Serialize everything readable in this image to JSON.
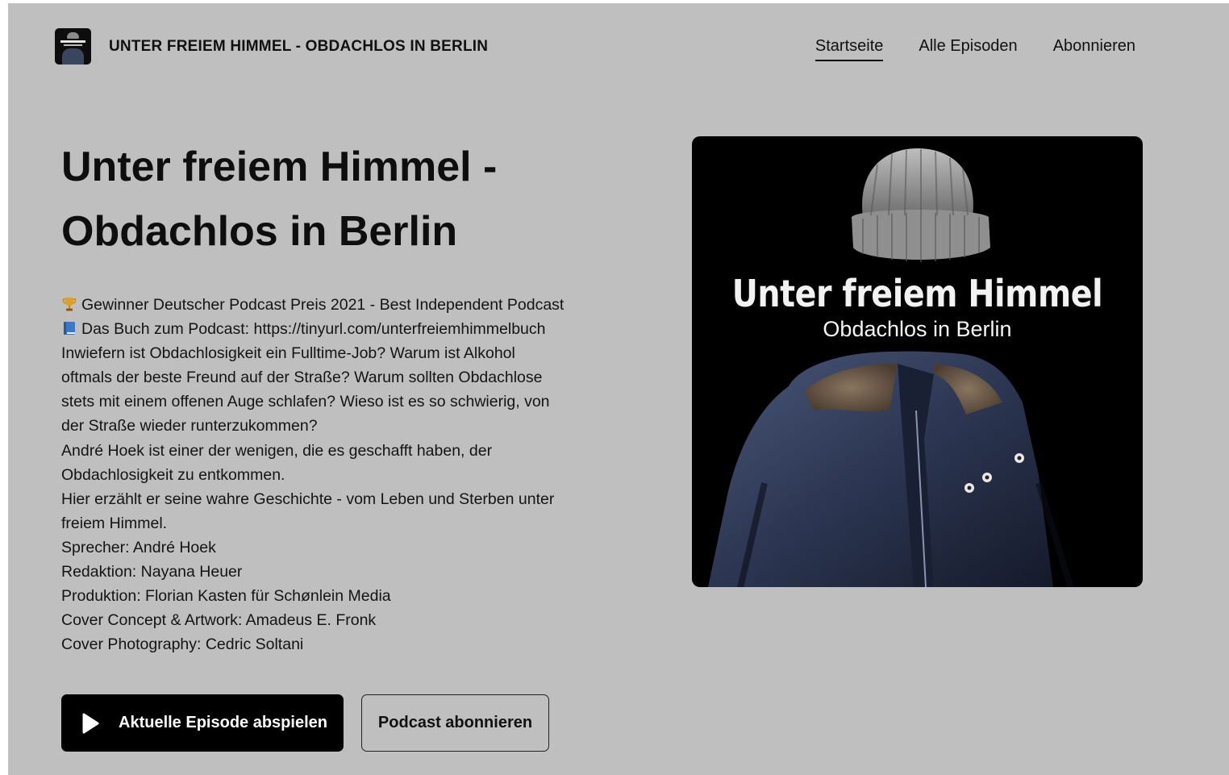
{
  "header": {
    "title": "UNTER FREIEM HIMMEL - OBDACHLOS IN BERLIN",
    "nav": [
      {
        "label": "Startseite",
        "active": true
      },
      {
        "label": "Alle Episoden",
        "active": false
      },
      {
        "label": "Abonnieren",
        "active": false
      }
    ]
  },
  "hero": {
    "title_line1": "Unter freiem Himmel -",
    "title_line2": "Obdachlos in Berlin",
    "description": [
      {
        "emoji": "trophy-icon",
        "text": "Gewinner Deutscher Podcast Preis 2021 - Best Independent Podcast"
      },
      {
        "emoji": "book-icon",
        "text": "Das Buch zum Podcast: https://tinyurl.com/unterfreiemhimmelbuch"
      },
      {
        "text": "Inwiefern ist Obdachlosigkeit ein Fulltime-Job? Warum ist Alkohol"
      },
      {
        "text": "oftmals der beste Freund auf der Straße? Warum sollten Obdachlose"
      },
      {
        "text": "stets mit einem offenen Auge schlafen? Wieso ist es so schwierig, von"
      },
      {
        "text": "der Straße wieder runterzukommen?"
      },
      {
        "text": "André Hoek ist einer der wenigen, die es geschafft haben, der"
      },
      {
        "text": "Obdachlosigkeit zu entkommen."
      },
      {
        "text": "Hier erzählt er seine wahre Geschichte - vom Leben und Sterben unter"
      },
      {
        "text": "freiem Himmel."
      },
      {
        "text": "Sprecher: André Hoek"
      },
      {
        "text": "Redaktion: Nayana Heuer"
      },
      {
        "text": "Produktion: Florian Kasten für Schønlein Media"
      },
      {
        "text": "Cover Concept & Artwork: Amadeus E. Fronk"
      },
      {
        "text": "Cover Photography: Cedric Soltani"
      }
    ],
    "play_button": "Aktuelle Episode abspielen",
    "subscribe_button": "Podcast abonnieren"
  },
  "cover": {
    "title": "Unter freiem Himmel",
    "subtitle": "Obdachlos in Berlin"
  },
  "colors": {
    "page_background": "#bfbfbf",
    "text": "#111111",
    "primary_button": "#000000"
  }
}
